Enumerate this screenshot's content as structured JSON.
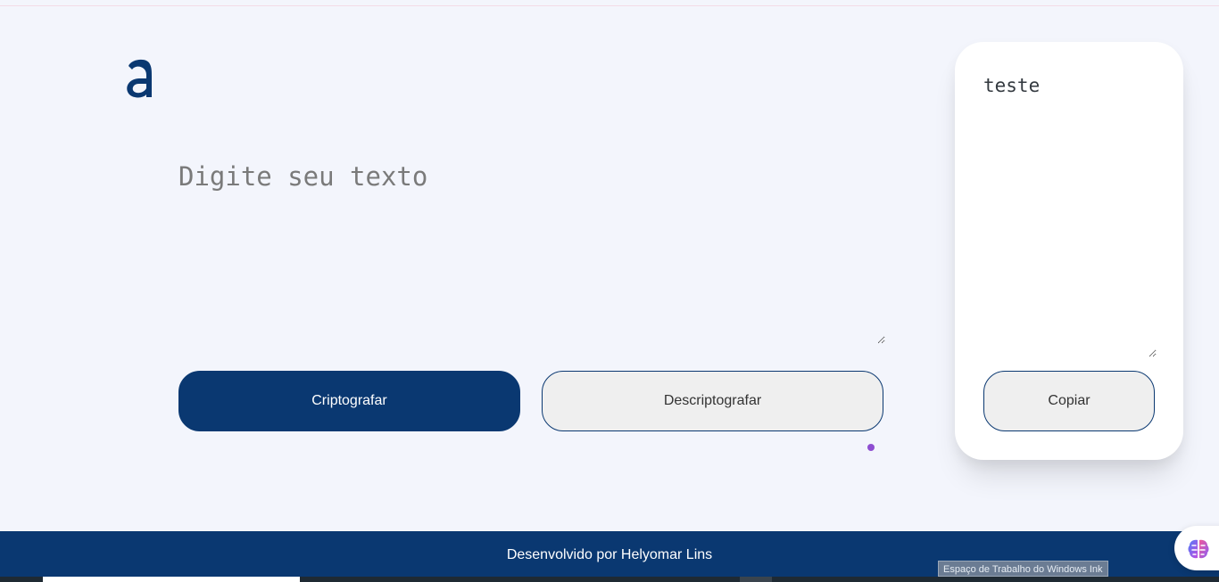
{
  "input": {
    "placeholder": "Digite seu texto",
    "value": ""
  },
  "buttons": {
    "encrypt_label": "Criptografar",
    "decrypt_label": "Descriptografar",
    "copy_label": "Copiar"
  },
  "output": {
    "value": "teste"
  },
  "footer": {
    "text": "Desenvolvido por Helyomar Lins"
  },
  "tooltip": {
    "text": "Espaço de Trabalho do Windows Ink"
  },
  "icons": {
    "logo": "alura-a-logo",
    "extension": "brain-icon"
  },
  "colors": {
    "primary": "#0a3871",
    "background": "#f3f5fc",
    "accent_dot": "#8e4ed1"
  }
}
